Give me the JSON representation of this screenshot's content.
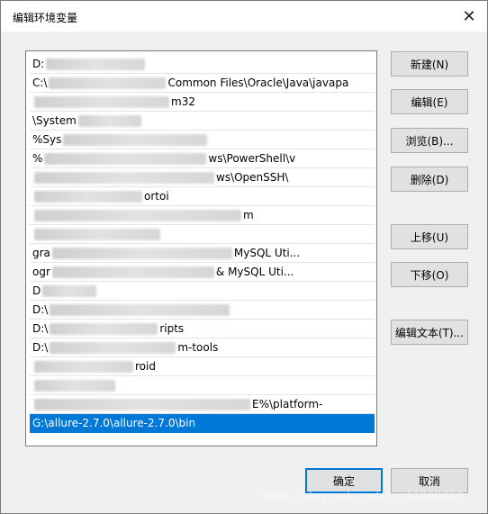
{
  "window": {
    "title": "编辑环境变量",
    "close_glyph": "✕"
  },
  "path_list": {
    "rows": [
      {
        "prefix": "D:",
        "suffix": ""
      },
      {
        "prefix": "C:\\",
        "suffix": "Common Files\\Oracle\\Java\\javapa"
      },
      {
        "prefix": "",
        "suffix": "m32"
      },
      {
        "prefix": "\\System",
        "suffix": ""
      },
      {
        "prefix": "%Sys",
        "suffix": ""
      },
      {
        "prefix": "%",
        "suffix": "ws\\PowerShell\\v"
      },
      {
        "prefix": "",
        "suffix": "ws\\OpenSSH\\"
      },
      {
        "prefix": "",
        "suffix": "ortoi"
      },
      {
        "prefix": "",
        "suffix": "m"
      },
      {
        "prefix": "",
        "suffix": ""
      },
      {
        "prefix": "  gra",
        "suffix": "MySQL Uti..."
      },
      {
        "prefix": "  ogr",
        "suffix": "& MySQL Uti..."
      },
      {
        "prefix": "D",
        "suffix": ""
      },
      {
        "prefix": "D:\\",
        "suffix": ""
      },
      {
        "prefix": "D:\\",
        "suffix": "ripts"
      },
      {
        "prefix": "D:\\",
        "suffix": "m-tools"
      },
      {
        "prefix": "",
        "suffix": "roid"
      },
      {
        "prefix": "",
        "suffix": ""
      },
      {
        "prefix": "",
        "suffix": "E%\\platform-"
      },
      {
        "prefix": "G:\\allure-2.7.0\\allure-2.7.0\\bin",
        "suffix": ""
      }
    ],
    "selected_index": 19
  },
  "buttons": {
    "new": "新建(N)",
    "edit": "编辑(E)",
    "browse": "浏览(B)...",
    "delete": "删除(D)",
    "move_up": "上移(U)",
    "move_down": "下移(O)",
    "edit_text": "编辑文本(T)...",
    "ok": "确定",
    "cancel": "取消"
  },
  "watermark": "https://blog.csdn.net/qq_41899990",
  "colors": {
    "selection": "#0078d7",
    "default_button_border": "#0078d7"
  }
}
